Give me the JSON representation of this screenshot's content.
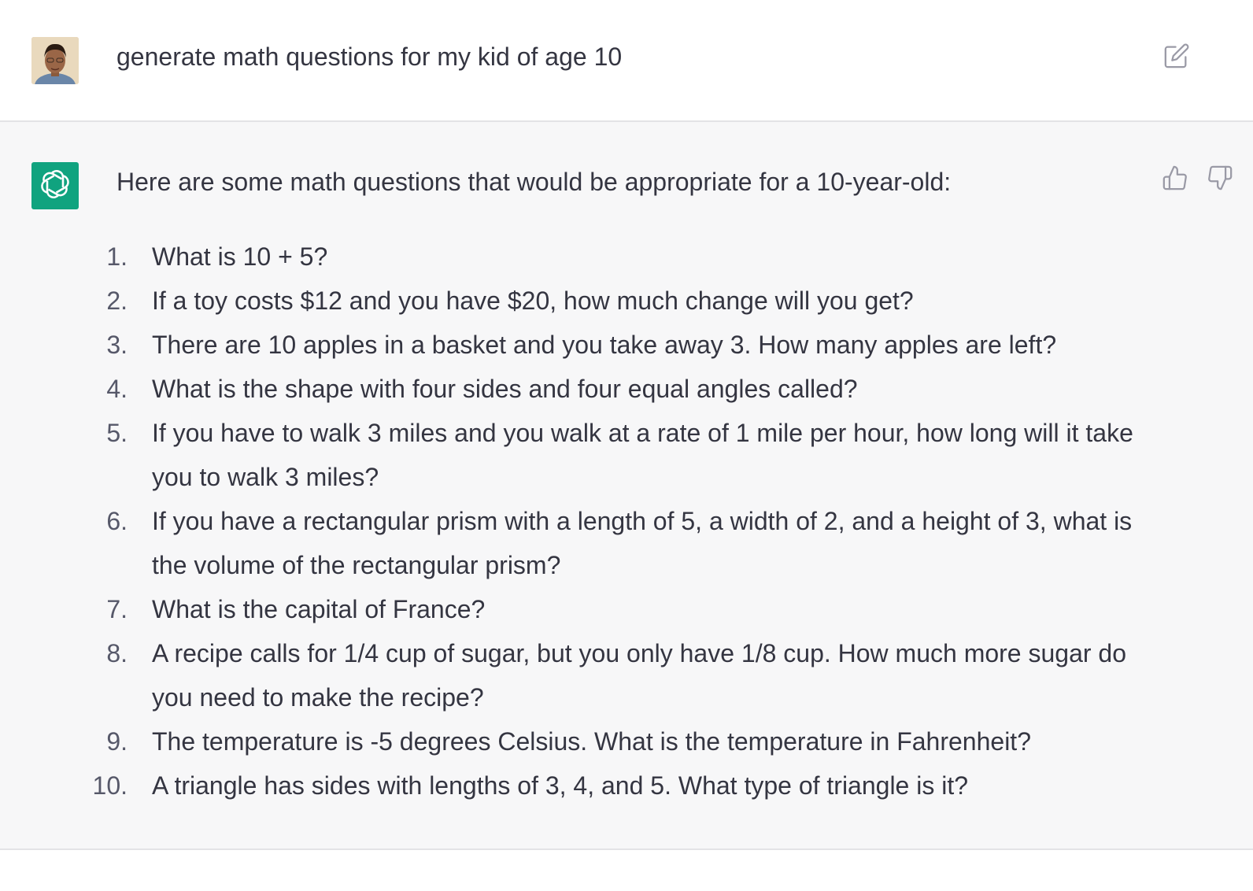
{
  "user_message": {
    "text": "generate math questions for my kid of age 10",
    "edit_icon": "edit-pencil-icon"
  },
  "assistant_message": {
    "intro": "Here are some math questions that would be appropriate for a 10-year-old:",
    "feedback_icons": [
      "thumbs-up-icon",
      "thumbs-down-icon"
    ],
    "questions": [
      {
        "num": "1.",
        "text": "What is 10 + 5?"
      },
      {
        "num": "2.",
        "text": "If a toy costs $12 and you have $20, how much change will you get?"
      },
      {
        "num": "3.",
        "text": "There are 10 apples in a basket and you take away 3. How many apples are left?"
      },
      {
        "num": "4.",
        "text": "What is the shape with four sides and four equal angles called?"
      },
      {
        "num": "5.",
        "text": "If you have to walk 3 miles and you walk at a rate of 1 mile per hour, how long will it take you to walk 3 miles?"
      },
      {
        "num": "6.",
        "text": "If you have a rectangular prism with a length of 5, a width of 2, and a height of 3, what is the volume of the rectangular prism?"
      },
      {
        "num": "7.",
        "text": "What is the capital of France?"
      },
      {
        "num": "8.",
        "text": "A recipe calls for 1/4 cup of sugar, but you only have 1/8 cup. How much more sugar do you need to make the recipe?"
      },
      {
        "num": "9.",
        "text": "The temperature is -5 degrees Celsius. What is the temperature in Fahrenheit?"
      },
      {
        "num": "10.",
        "text": "A triangle has sides with lengths of 3, 4, and 5. What type of triangle is it?"
      }
    ]
  },
  "colors": {
    "assistant_bg": "#f7f7f8",
    "bot_avatar": "#10a37f",
    "text": "#343541"
  }
}
